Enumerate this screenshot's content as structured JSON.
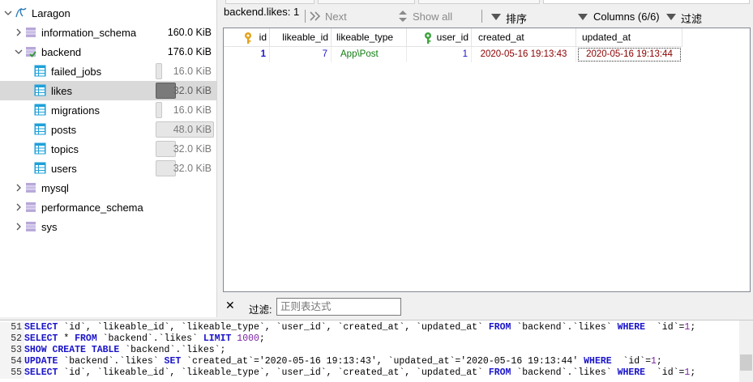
{
  "tree": {
    "root": {
      "label": "Laragon",
      "icon": "server-icon"
    },
    "databases": [
      {
        "label": "information_schema",
        "size": "160.0 KiB",
        "expanded": false
      },
      {
        "label": "backend",
        "size": "176.0 KiB",
        "expanded": true
      },
      {
        "label": "mysql",
        "size": "",
        "expanded": false
      },
      {
        "label": "performance_schema",
        "size": "",
        "expanded": false
      },
      {
        "label": "sys",
        "size": "",
        "expanded": false
      }
    ],
    "tables": [
      {
        "label": "failed_jobs",
        "size": "16.0 KiB",
        "fill": 0.33
      },
      {
        "label": "likes",
        "size": "32.0 KiB",
        "fill": 0.67,
        "selected": true
      },
      {
        "label": "migrations",
        "size": "16.0 KiB",
        "fill": 0.33
      },
      {
        "label": "posts",
        "size": "48.0 KiB",
        "fill": 1.0
      },
      {
        "label": "topics",
        "size": "32.0 KiB",
        "fill": 0.67
      },
      {
        "label": "users",
        "size": "32.0 KiB",
        "fill": 0.67
      }
    ]
  },
  "toolbar": {
    "title": "backend.likes: 1",
    "next": "Next",
    "show_all": "Show all",
    "sort": "排序",
    "columns": "Columns (6/6)",
    "filter": "过滤"
  },
  "grid": {
    "columns": [
      "id",
      "likeable_id",
      "likeable_type",
      "user_id",
      "created_at",
      "updated_at"
    ],
    "rows": [
      {
        "id": "1",
        "likeable_id": "7",
        "likeable_type": "App\\Post",
        "user_id": "1",
        "created_at": "2020-05-16 19:13:43",
        "updated_at": "2020-05-16 19:13:44"
      }
    ]
  },
  "filterbar": {
    "close": "✕",
    "label": "过滤:",
    "placeholder": "正则表达式"
  },
  "sqllog": [
    {
      "n": "51",
      "tokens": [
        [
          "kw",
          "SELECT "
        ],
        [
          "idn",
          "`id`, `likeable_id`, `likeable_type`, `user_id`, `created_at`, `updated_at` "
        ],
        [
          "kw",
          "FROM "
        ],
        [
          "idn",
          "`backend`.`likes` "
        ],
        [
          "kw",
          "WHERE "
        ],
        [
          "idn",
          " `id`="
        ],
        [
          "num",
          "1"
        ],
        [
          "idn",
          ";"
        ]
      ]
    },
    {
      "n": "52",
      "tokens": [
        [
          "kw",
          "SELECT "
        ],
        [
          "idn",
          "* "
        ],
        [
          "kw",
          "FROM "
        ],
        [
          "idn",
          "`backend`.`likes` "
        ],
        [
          "kw",
          "LIMIT "
        ],
        [
          "num",
          "1000"
        ],
        [
          "idn",
          ";"
        ]
      ]
    },
    {
      "n": "53",
      "tokens": [
        [
          "kw",
          "SHOW CREATE TABLE "
        ],
        [
          "idn",
          "`backend`.`likes`;"
        ]
      ]
    },
    {
      "n": "54",
      "tokens": [
        [
          "kw",
          "UPDATE "
        ],
        [
          "idn",
          "`backend`.`likes` "
        ],
        [
          "kw",
          "SET "
        ],
        [
          "idn",
          "`created_at`='2020-05-16 19:13:43', `updated_at`='2020-05-16 19:13:44' "
        ],
        [
          "kw",
          "WHERE "
        ],
        [
          "idn",
          " `id`="
        ],
        [
          "num",
          "1"
        ],
        [
          "idn",
          ";"
        ]
      ]
    },
    {
      "n": "55",
      "tokens": [
        [
          "kw",
          "SELECT "
        ],
        [
          "idn",
          "`id`, `likeable_id`, `likeable_type`, `user_id`, `created_at`, `updated_at` "
        ],
        [
          "kw",
          "FROM "
        ],
        [
          "idn",
          "`backend`.`likes` "
        ],
        [
          "kw",
          "WHERE "
        ],
        [
          "idn",
          " `id`="
        ],
        [
          "num",
          "1"
        ],
        [
          "idn",
          ";"
        ]
      ]
    }
  ],
  "colors": {
    "id_text": "#1a14c9",
    "number_text": "#1a14c9",
    "string_text": "#107c10",
    "date_text": "#8b0000",
    "tree_selection": "#d9d9d9",
    "table_icon": "#1fa0d8"
  }
}
